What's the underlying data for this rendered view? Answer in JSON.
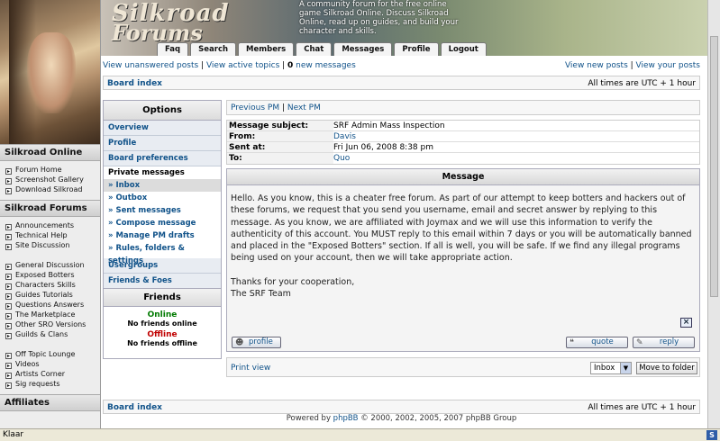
{
  "banner": {
    "logo_top": "Silkroad",
    "logo_bottom": "Forums",
    "blurb": "A community forum for the free online game Silkroad Online. Discuss Silkroad Online, read up on guides, and build your character and skills.",
    "nav": [
      "Faq",
      "Search",
      "Members",
      "Chat",
      "Messages",
      "Profile",
      "Logout"
    ]
  },
  "sidebar": {
    "section1_title": "Silkroad Online",
    "section1_items": [
      "Forum Home",
      "Screenshot Gallery",
      "Download Silkroad"
    ],
    "section2_title": "Silkroad Forums",
    "section2_group_a": [
      "Announcements",
      "Technical Help",
      "Site Discussion"
    ],
    "section2_group_b": [
      "General Discussion",
      "Exposed Botters",
      "Characters Skills",
      "Guides Tutorials",
      "Questions Answers",
      "The Marketplace",
      "Other SRO Versions",
      "Guilds & Clans"
    ],
    "section2_group_c": [
      "Off Topic Lounge",
      "Videos",
      "Artists Corner",
      "Sig requests"
    ],
    "section3_title": "Affiliates"
  },
  "topbar": {
    "left_1": "View unanswered posts",
    "left_sep1": " | ",
    "left_2": "View active topics",
    "left_sep2": " | ",
    "new_count": "0",
    "left_3": " new messages",
    "right_1": "View new posts",
    "right_sep": " | ",
    "right_2": "View your posts"
  },
  "crumb": {
    "board_index": "Board index",
    "timezone": "All times are UTC + 1 hour"
  },
  "options": {
    "title": "Options",
    "items_top": [
      "Overview",
      "Profile",
      "Board preferences"
    ],
    "pm_header": "Private messages",
    "pm_items": [
      "» Inbox",
      "» Outbox",
      "» Sent messages",
      "» Compose message",
      "» Manage PM drafts",
      "» Rules, folders & settings"
    ],
    "items_bottom": [
      "Usergroups",
      "Friends & Foes"
    ]
  },
  "friends": {
    "title": "Friends",
    "online_label": "Online",
    "online_empty": "No friends online",
    "offline_label": "Offline",
    "offline_empty": "No friends offline"
  },
  "pmnav": {
    "prev": "Previous PM",
    "sep": " | ",
    "next": "Next PM"
  },
  "message_info": {
    "subject_label": "Message subject:",
    "subject": "SRF Admin Mass Inspection",
    "from_label": "From:",
    "from": "Davis",
    "sent_label": "Sent at:",
    "sent": "Fri Jun 06, 2008 8:38 pm",
    "to_label": "To:",
    "to": "Quo"
  },
  "message": {
    "header": "Message",
    "body_1": "Hello. As you know, this is a cheater free forum. As part of our attempt to keep botters and hackers out of these forums, we request that you send you username, email and secret answer by replying to this message. As you know, we are affiliated with Joymax and we will use this information to verify the authenticity of this account. You MUST reply to this email within 7 days or you will be automatically banned and placed in the \"Exposed Botters\" section. If all is well, you will be safe. If we find any illegal programs being used on your account, then we will take appropriate action.",
    "body_2": "Thanks for your cooperation,",
    "body_3": "The SRF Team",
    "close_glyph": "×",
    "profile_btn": "profile",
    "quote_btn": "quote",
    "reply_btn": "reply"
  },
  "bottom": {
    "print_view": "Print view",
    "folder_select": "Inbox",
    "move_btn": "Move to folder"
  },
  "footer": {
    "prefix": "Powered by ",
    "brand": "phpBB",
    "suffix": " © 2000, 2002, 2005, 2007 phpBB Group"
  },
  "status": {
    "text": "Klaar",
    "icon": "S"
  }
}
